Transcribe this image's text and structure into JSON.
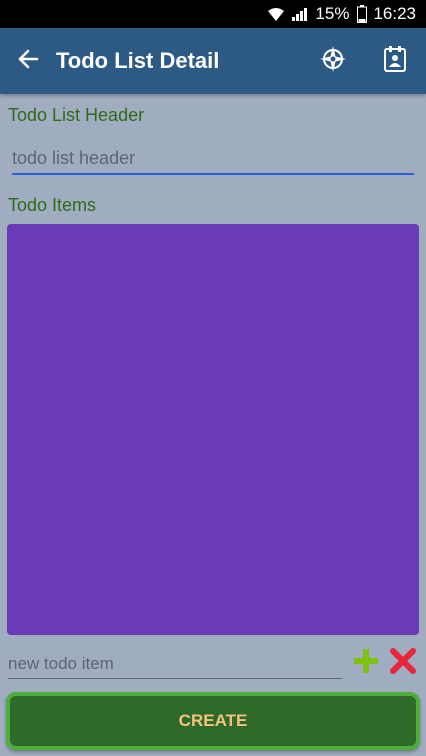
{
  "status_bar": {
    "battery": "15%",
    "time": "16:23",
    "icons": [
      "wifi-icon",
      "signal-icon",
      "battery-icon"
    ]
  },
  "app_bar": {
    "title": "Todo List Detail",
    "back_icon": "arrow-left-icon",
    "actions": [
      "location-target-icon",
      "calendar-contact-icon"
    ],
    "color": "#2d5a84"
  },
  "form": {
    "header_label": "Todo List Header",
    "header_placeholder": "todo list header",
    "items_label": "Todo Items",
    "items_list_color": "#6b3ab5",
    "new_item_placeholder": "new todo item",
    "add_icon": "plus-icon",
    "delete_icon": "x-icon",
    "create_label": "CREATE"
  }
}
